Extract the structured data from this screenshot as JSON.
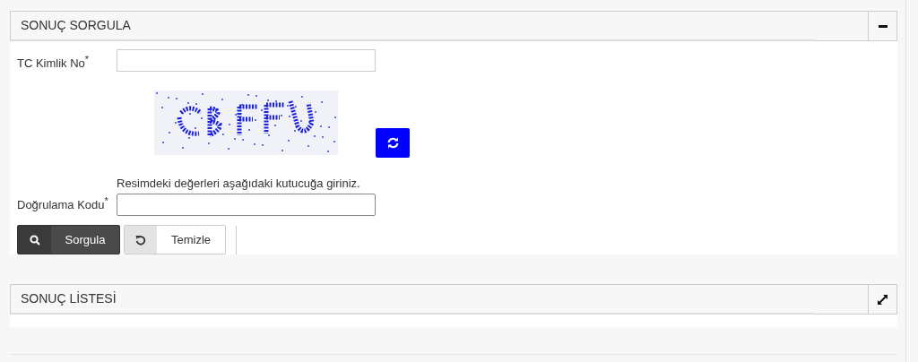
{
  "query_panel": {
    "title": "SONUÇ SORGULA",
    "header_button": {
      "kind": "collapse"
    },
    "tc_field": {
      "label": "TC Kimlik No",
      "required_mark": "*"
    },
    "captcha_hint": "Resimdeki değerleri aşağıdaki kutucuğa giriniz.",
    "code_field": {
      "label": "Doğrulama Kodu",
      "required_mark": "*"
    },
    "buttons": [
      {
        "kind": "search",
        "label": "Sorgula"
      },
      {
        "kind": "reset",
        "label": "Temizle"
      }
    ]
  },
  "result_panel": {
    "title": "SONUÇ LİSTESİ",
    "header_button": {
      "kind": "expand"
    }
  }
}
